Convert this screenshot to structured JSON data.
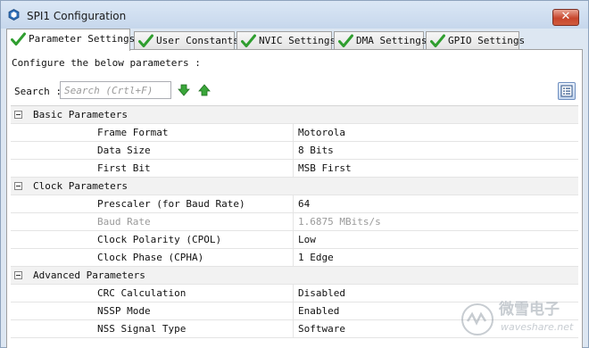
{
  "window": {
    "title": "SPI1 Configuration",
    "close_label": "✕"
  },
  "tabs": [
    {
      "label": "Parameter Settings",
      "active": true
    },
    {
      "label": "User Constants",
      "active": false
    },
    {
      "label": "NVIC Settings",
      "active": false
    },
    {
      "label": "DMA Settings",
      "active": false
    },
    {
      "label": "GPIO Settings",
      "active": false
    }
  ],
  "panel": {
    "instruction": "Configure the below parameters :",
    "search_label": "Search :",
    "search_placeholder": "Search (Crtl+F)"
  },
  "groups": [
    {
      "label": "Basic Parameters",
      "params": [
        {
          "name": "Frame Format",
          "value": "Motorola",
          "disabled": false
        },
        {
          "name": "Data Size",
          "value": "8 Bits",
          "disabled": false
        },
        {
          "name": "First Bit",
          "value": "MSB First",
          "disabled": false
        }
      ]
    },
    {
      "label": "Clock Parameters",
      "params": [
        {
          "name": "Prescaler (for Baud Rate)",
          "value": "64",
          "disabled": false
        },
        {
          "name": "Baud Rate",
          "value": "1.6875 MBits/s",
          "disabled": true
        },
        {
          "name": "Clock Polarity (CPOL)",
          "value": "Low",
          "disabled": false
        },
        {
          "name": "Clock Phase (CPHA)",
          "value": "1 Edge",
          "disabled": false
        }
      ]
    },
    {
      "label": "Advanced Parameters",
      "params": [
        {
          "name": "CRC Calculation",
          "value": "Disabled",
          "disabled": false
        },
        {
          "name": "NSSP Mode",
          "value": "Enabled",
          "disabled": false
        },
        {
          "name": "NSS Signal Type",
          "value": "Software",
          "disabled": false
        }
      ]
    }
  ],
  "watermark": {
    "brand_cn": "微雪电子",
    "site": "waveshare.net"
  },
  "colors": {
    "check_green": "#2f9e2f",
    "arrow_green": "#3aa63a"
  }
}
